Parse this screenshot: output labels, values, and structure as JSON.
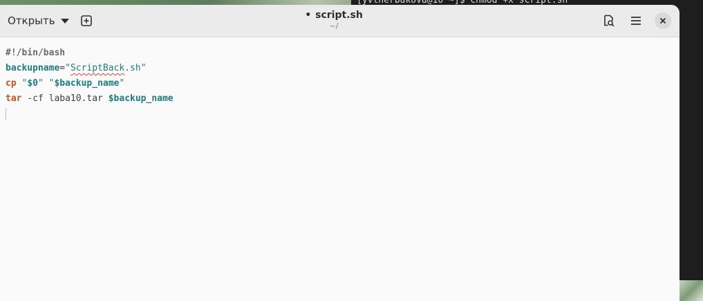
{
  "background": {
    "terminal_line": "[yvtherbakova@10 ~]$ chmod +x script.sh"
  },
  "headerbar": {
    "open_label": "Открыть",
    "title_dot": "•",
    "title": "script.sh",
    "subtitle": "~/"
  },
  "editor": {
    "lines": [
      [
        {
          "cls": "c-comment",
          "text": "#!/bin/bash"
        }
      ],
      [
        {
          "cls": "c-var",
          "text": "backupname"
        },
        {
          "cls": "c-plain",
          "text": "="
        },
        {
          "cls": "c-str",
          "text": "\""
        },
        {
          "cls": "c-str spell",
          "text": "ScriptBack"
        },
        {
          "cls": "c-str",
          "text": ".sh\""
        }
      ],
      [
        {
          "cls": "c-cmd",
          "text": "cp"
        },
        {
          "cls": "c-plain",
          "text": " "
        },
        {
          "cls": "c-str",
          "text": "\""
        },
        {
          "cls": "c-var",
          "text": "$0"
        },
        {
          "cls": "c-str",
          "text": "\""
        },
        {
          "cls": "c-plain",
          "text": " "
        },
        {
          "cls": "c-str",
          "text": "\""
        },
        {
          "cls": "c-var",
          "text": "$backup_name"
        },
        {
          "cls": "c-str",
          "text": "\""
        }
      ],
      [
        {
          "cls": "c-cmd",
          "text": "tar"
        },
        {
          "cls": "c-plain",
          "text": " -cf laba10.tar "
        },
        {
          "cls": "c-var",
          "text": "$backup_name"
        }
      ]
    ]
  },
  "icons": {
    "open_caret": "chevron-down-icon",
    "new_tab": "new-tab-icon",
    "search": "document-search-icon",
    "menu": "hamburger-menu-icon",
    "close": "close-icon"
  },
  "colors": {
    "keyword": "#c2541d",
    "variable": "#1e7a7f",
    "comment": "#6b6b6b",
    "header_bg": "#ebebeb",
    "editor_bg": "#fafafa"
  }
}
